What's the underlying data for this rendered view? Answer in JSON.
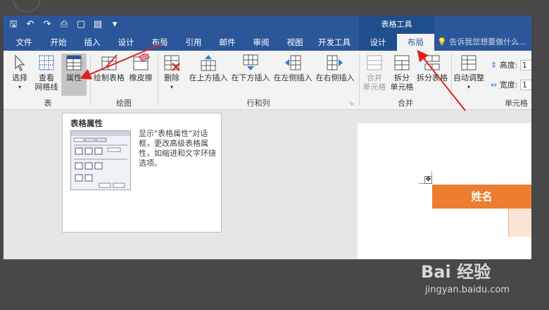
{
  "titlebar": {
    "context_group": "表格工具"
  },
  "tabs": [
    {
      "label": "文件"
    },
    {
      "label": "开始"
    },
    {
      "label": "插入"
    },
    {
      "label": "设计"
    },
    {
      "label": "布局"
    },
    {
      "label": "引用"
    },
    {
      "label": "邮件"
    },
    {
      "label": "审阅"
    },
    {
      "label": "视图"
    },
    {
      "label": "开发工具"
    },
    {
      "label": "设计"
    },
    {
      "label": "布局"
    }
  ],
  "search_placeholder": "告诉我您想要做什么...",
  "ribbon": {
    "select": "选择",
    "view_gridlines": [
      "查看",
      "网格线"
    ],
    "properties": "属性",
    "draw_table": "绘制表格",
    "eraser": "橡皮擦",
    "delete": "删除",
    "insert_above": "在上方插入",
    "insert_below": "在下方插入",
    "insert_left": "在左侧插入",
    "insert_right": "在右侧插入",
    "merge_cells": [
      "合并",
      "单元格"
    ],
    "split_cells": [
      "拆分",
      "单元格"
    ],
    "split_table": "拆分表格",
    "autofit": "自动调整",
    "height_label": "高度:",
    "width_label": "宽度:",
    "height_value": "1",
    "width_value": "1",
    "groups": {
      "table": "表",
      "draw": "绘图",
      "rows_cols": "行和列",
      "merge": "合并",
      "cell_size": "单元格"
    }
  },
  "tooltip": {
    "title": "表格属性",
    "body": "显示\"表格属性\"对话框，更改高级表格属性，如缩进和文字环绕选项。"
  },
  "document": {
    "header_cell": "姓名"
  },
  "watermark": {
    "brand": "Bai 经验",
    "url": "jingyan.baidu.com"
  },
  "colors": {
    "ribbon_blue": "#2b579a",
    "table_orange": "#ed7d31",
    "arrow_red": "#e02020"
  }
}
